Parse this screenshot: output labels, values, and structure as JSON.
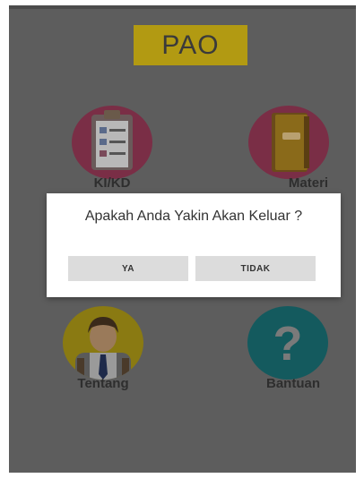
{
  "app": {
    "title": "PAO"
  },
  "menu": {
    "items": [
      {
        "label": "KI/KD",
        "icon": "clipboard-icon"
      },
      {
        "label": "Materi",
        "icon": "book-icon"
      },
      {
        "label": "Tentang",
        "icon": "person-icon"
      },
      {
        "label": "Bantuan",
        "icon": "question-mark-icon"
      }
    ]
  },
  "dialog": {
    "message": "Apakah Anda Yakin Akan Keluar ?",
    "confirm_label": "YA",
    "cancel_label": "TIDAK"
  },
  "colors": {
    "screen_overlay": "#5d5d5d",
    "title_box": "#b29a12",
    "dialog_bg": "#ffffff",
    "button_bg": "#dcdcdc"
  }
}
